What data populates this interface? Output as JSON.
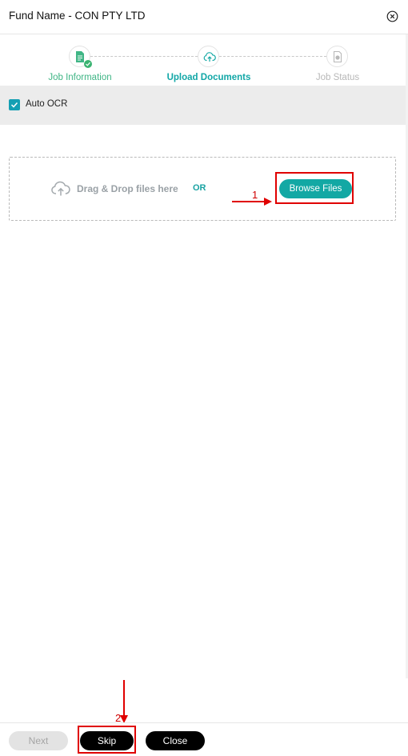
{
  "header": {
    "title": "Fund Name - CON PTY LTD",
    "close_icon": "close-circle-icon"
  },
  "stepper": {
    "steps": [
      {
        "label": "Job Information",
        "icon": "document-icon",
        "state": "completed"
      },
      {
        "label": "Upload Documents",
        "icon": "cloud-upload-icon",
        "state": "active"
      },
      {
        "label": "Job Status",
        "icon": "status-document-icon",
        "state": "pending"
      }
    ]
  },
  "options": {
    "auto_ocr_label": "Auto OCR",
    "auto_ocr_checked": true
  },
  "dropzone": {
    "drag_text": "Drag & Drop files here",
    "or_text": "OR",
    "browse_label": "Browse Files"
  },
  "annotations": {
    "first_number": "1",
    "second_number": "2"
  },
  "footer": {
    "next_label": "Next",
    "skip_label": "Skip",
    "close_label": "Close"
  },
  "colors": {
    "accent": "#13a8a4",
    "completed": "#3fb585",
    "annotation": "#e00000"
  }
}
